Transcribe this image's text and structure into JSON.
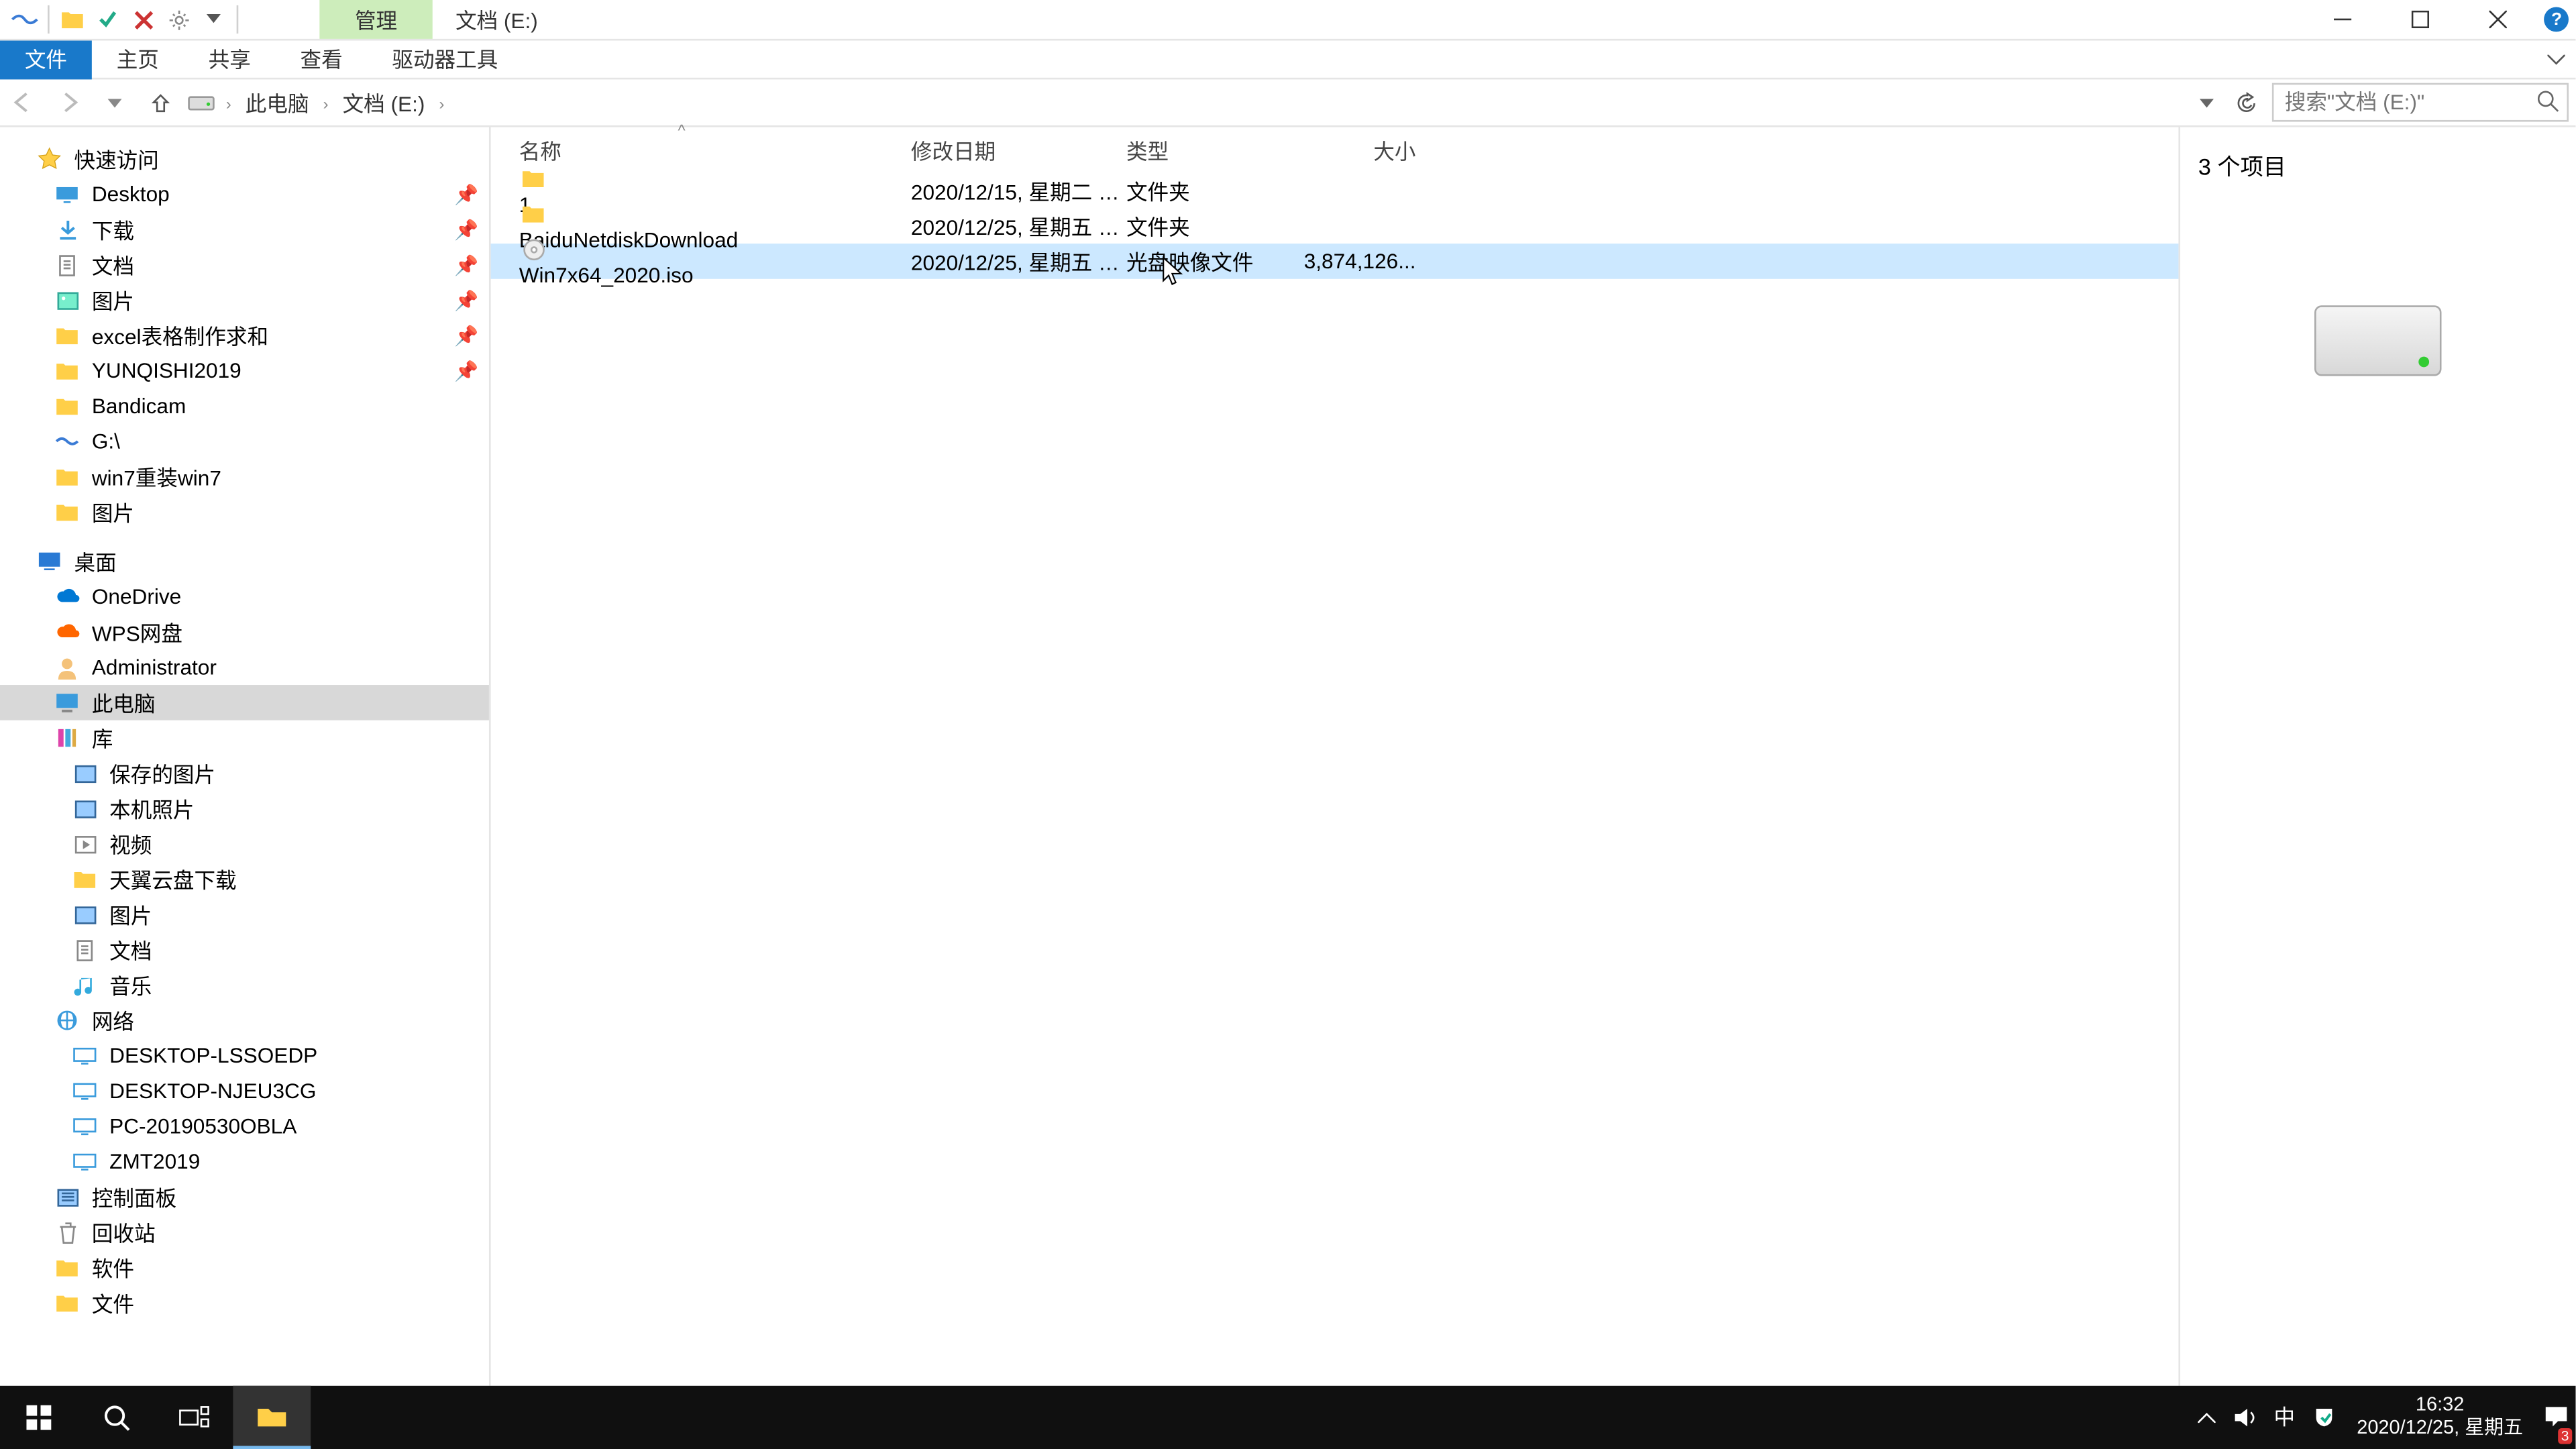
{
  "title": "文档 (E:)",
  "ribbon_context": "管理",
  "ribbon": {
    "file": "文件",
    "home": "主页",
    "share": "共享",
    "view": "查看",
    "drive": "驱动器工具"
  },
  "breadcrumbs": [
    "此电脑",
    "文档 (E:)"
  ],
  "search_placeholder": "搜索\"文档 (E:)\"",
  "columns": {
    "name": "名称",
    "date": "修改日期",
    "type": "类型",
    "size": "大小"
  },
  "files": [
    {
      "icon": "folder",
      "name": "1",
      "date": "2020/12/15, 星期二 1...",
      "type": "文件夹",
      "size": ""
    },
    {
      "icon": "folder",
      "name": "BaiduNetdiskDownload",
      "date": "2020/12/25, 星期五 1...",
      "type": "文件夹",
      "size": ""
    },
    {
      "icon": "iso",
      "name": "Win7x64_2020.iso",
      "date": "2020/12/25, 星期五 1...",
      "type": "光盘映像文件",
      "size": "3,874,126...",
      "selected": true
    }
  ],
  "nav": {
    "quick": "快速访问",
    "quick_items": [
      {
        "label": "Desktop",
        "icon": "desktop",
        "pin": true
      },
      {
        "label": "下载",
        "icon": "download",
        "pin": true
      },
      {
        "label": "文档",
        "icon": "doc",
        "pin": true
      },
      {
        "label": "图片",
        "icon": "pic",
        "pin": true
      },
      {
        "label": "excel表格制作求和",
        "icon": "folder",
        "pin": true
      },
      {
        "label": "YUNQISHI2019",
        "icon": "folder",
        "pin": true
      },
      {
        "label": "Bandicam",
        "icon": "folder"
      },
      {
        "label": "G:\\",
        "icon": "shortcut"
      },
      {
        "label": "win7重装win7",
        "icon": "folder"
      },
      {
        "label": "图片",
        "icon": "folder"
      }
    ],
    "desktop": "桌面",
    "desktop_items": [
      {
        "label": "OneDrive",
        "icon": "cloud-blue"
      },
      {
        "label": "WPS网盘",
        "icon": "cloud-orange"
      },
      {
        "label": "Administrator",
        "icon": "user"
      },
      {
        "label": "此电脑",
        "icon": "pc",
        "selected": true
      },
      {
        "label": "库",
        "icon": "lib"
      },
      {
        "label": "保存的图片",
        "icon": "pic2",
        "depth": 2
      },
      {
        "label": "本机照片",
        "icon": "pic2",
        "depth": 2
      },
      {
        "label": "视频",
        "icon": "video",
        "depth": 2
      },
      {
        "label": "天翼云盘下载",
        "icon": "folder",
        "depth": 2
      },
      {
        "label": "图片",
        "icon": "pic2",
        "depth": 2
      },
      {
        "label": "文档",
        "icon": "doc",
        "depth": 2
      },
      {
        "label": "音乐",
        "icon": "music",
        "depth": 2
      },
      {
        "label": "网络",
        "icon": "net"
      },
      {
        "label": "DESKTOP-LSSOEDP",
        "icon": "netpc",
        "depth": 2
      },
      {
        "label": "DESKTOP-NJEU3CG",
        "icon": "netpc",
        "depth": 2
      },
      {
        "label": "PC-20190530OBLA",
        "icon": "netpc",
        "depth": 2
      },
      {
        "label": "ZMT2019",
        "icon": "netpc",
        "depth": 2
      },
      {
        "label": "控制面板",
        "icon": "cpl"
      },
      {
        "label": "回收站",
        "icon": "bin"
      },
      {
        "label": "软件",
        "icon": "folder"
      },
      {
        "label": "文件",
        "icon": "folder"
      }
    ]
  },
  "preview_count": "3 个项目",
  "status_text": "3 个项目",
  "clock": {
    "time": "16:32",
    "date": "2020/12/25, 星期五"
  },
  "ime": "中",
  "notif_badge": "3"
}
